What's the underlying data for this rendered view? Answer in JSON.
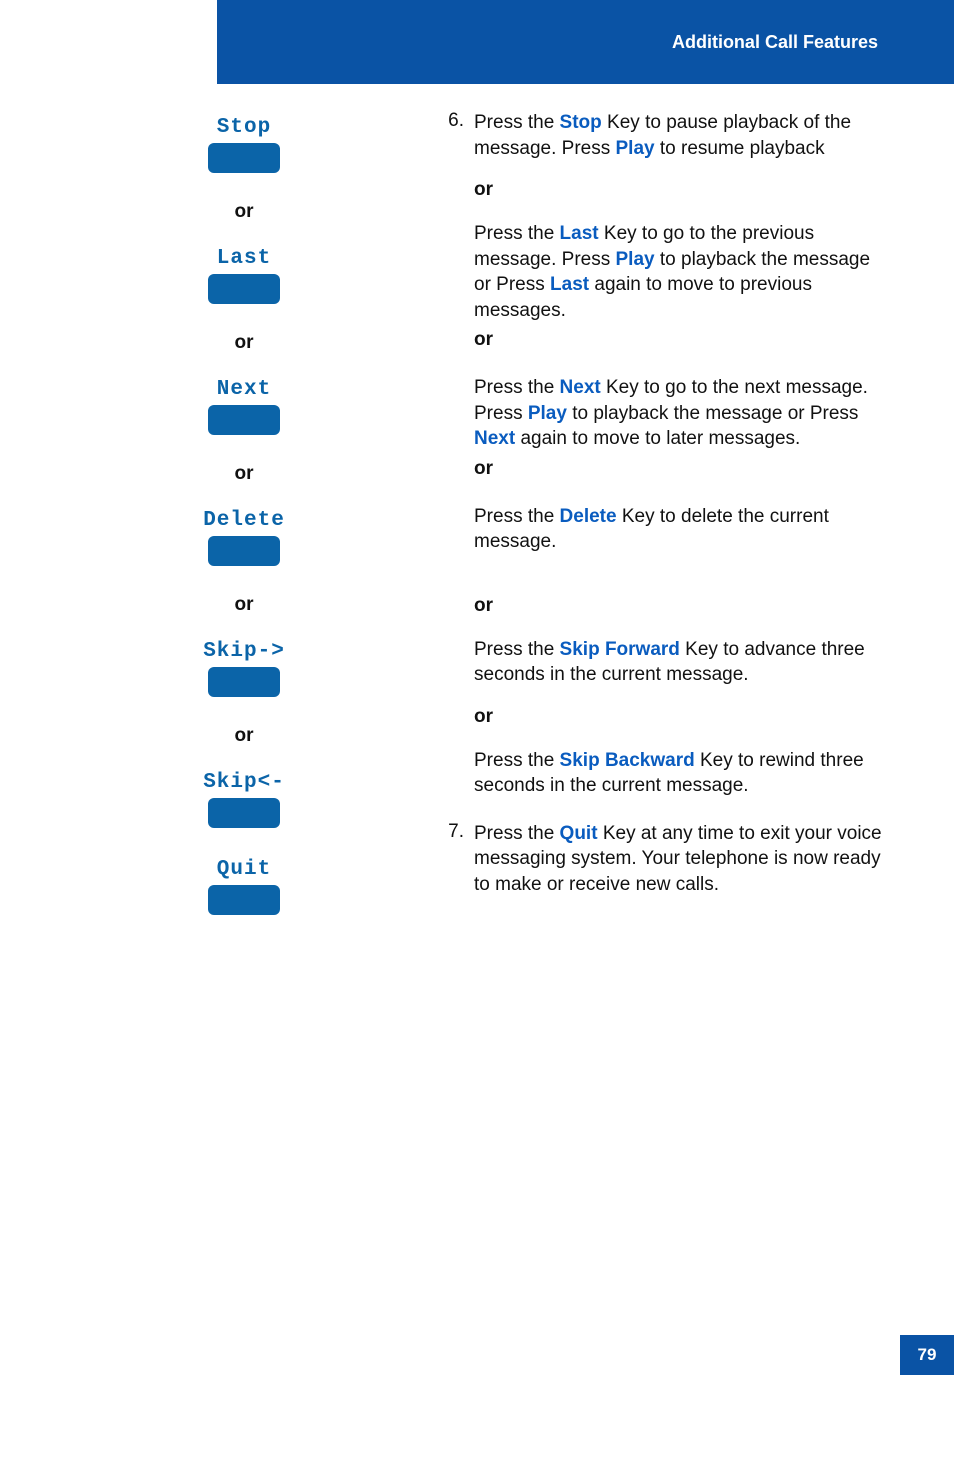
{
  "header": {
    "title": "Additional Call Features"
  },
  "page_number": "79",
  "left": {
    "keys": {
      "stop": "Stop",
      "last": "Last",
      "next": "Next",
      "delete": "Delete",
      "skip_fwd": "Skip->",
      "skip_back": "Skip<-",
      "quit": "Quit"
    },
    "or": "or"
  },
  "right": {
    "step6_num": "6.",
    "step7_num": "7.",
    "press_the": "Press the ",
    "kw": {
      "stop": "Stop",
      "play": "Play",
      "last": "Last",
      "next": "Next",
      "delete": "Delete",
      "skip_fwd": "Skip Forward",
      "skip_back": "Skip Backward",
      "quit": "Quit"
    },
    "s6_a_1": " Key to pause playback of the message. Press ",
    "s6_a_2": " to resume playback",
    "or": "or",
    "s6_b_1": " Key to go to the previous message. Press ",
    "s6_b_2": " to playback the message or Press ",
    "s6_b_3": " again to move to previous messages.",
    "or_bold_inline": "or",
    "s6_c_1": " Key to go to the next message. Press ",
    "s6_c_2": " to playback the message or Press ",
    "s6_c_3": " again to move to later messages.",
    "s6_d_1": " Key to delete the current message.",
    "s6_e_1": " Key to advance three seconds in the current message.",
    "s6_f_1": " Key to rewind three seconds in the current message.",
    "s7_1": " Key at any time to exit your voice messaging system. Your telephone is now ready to make or receive new calls."
  }
}
